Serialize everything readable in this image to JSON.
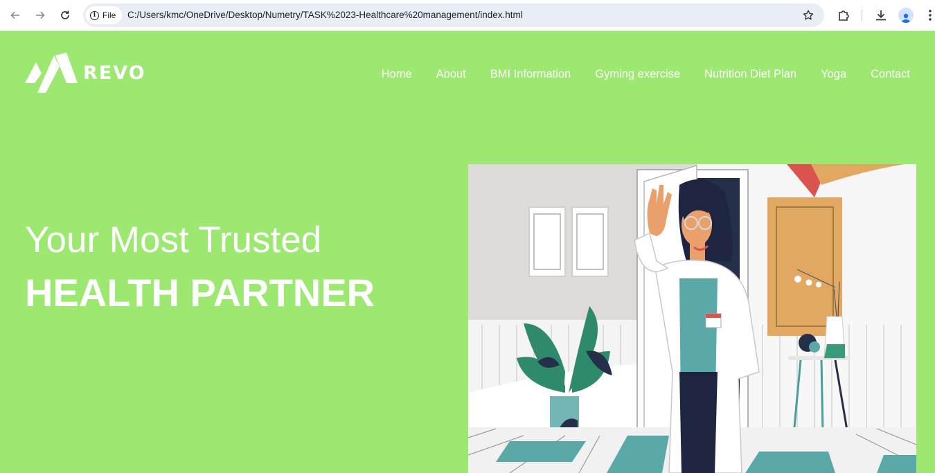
{
  "browser": {
    "file_label": "File",
    "url": "C:/Users/kmc/OneDrive/Desktop/Numetry/TASK%2023-Healthcare%20management/index.html",
    "icons": [
      "back-arrow-icon",
      "forward-arrow-icon",
      "reload-icon",
      "info-icon",
      "star-icon",
      "extensions-icon",
      "download-icon",
      "profile-icon",
      "menu-dots-icon"
    ]
  },
  "site": {
    "logo_text": "REVO",
    "nav": [
      "Home",
      "About",
      "BMI Information",
      "Gyming exercise",
      "Nutrition Diet Plan",
      "Yoga",
      "Contact"
    ],
    "hero": {
      "line1": "Your Most Trusted",
      "line2": "HEALTH PARTNER"
    }
  },
  "colors": {
    "page_background": "#9de870",
    "text": "#ffffff",
    "accent_teal": "#5aa9a8",
    "accent_orange": "#e2a862"
  }
}
